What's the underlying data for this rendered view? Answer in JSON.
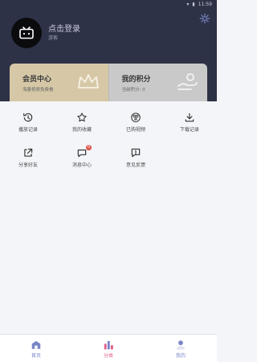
{
  "status": {
    "time": "11:59"
  },
  "profile": {
    "login_text": "点击登录",
    "role_text": "游客"
  },
  "cards": {
    "member": {
      "title": "会员中心",
      "subtitle": "海量视频免费看"
    },
    "points": {
      "title": "我的积分",
      "subtitle": "当前积分: 0"
    }
  },
  "menu": [
    {
      "label": "播放记录",
      "icon": "history-icon"
    },
    {
      "label": "我的收藏",
      "icon": "star-icon"
    },
    {
      "label": "已购视频",
      "icon": "purchased-video-icon"
    },
    {
      "label": "下载记录",
      "icon": "download-icon"
    },
    {
      "label": "分享好友",
      "icon": "share-icon"
    },
    {
      "label": "消息中心",
      "icon": "message-icon",
      "badge": "0"
    },
    {
      "label": "意见反馈",
      "icon": "feedback-icon"
    }
  ],
  "tabs": [
    {
      "label": "首页",
      "color": "#7b86c9"
    },
    {
      "label": "分类",
      "color": "#e3608c"
    },
    {
      "label": "我的",
      "color": "#7b86c9"
    }
  ]
}
